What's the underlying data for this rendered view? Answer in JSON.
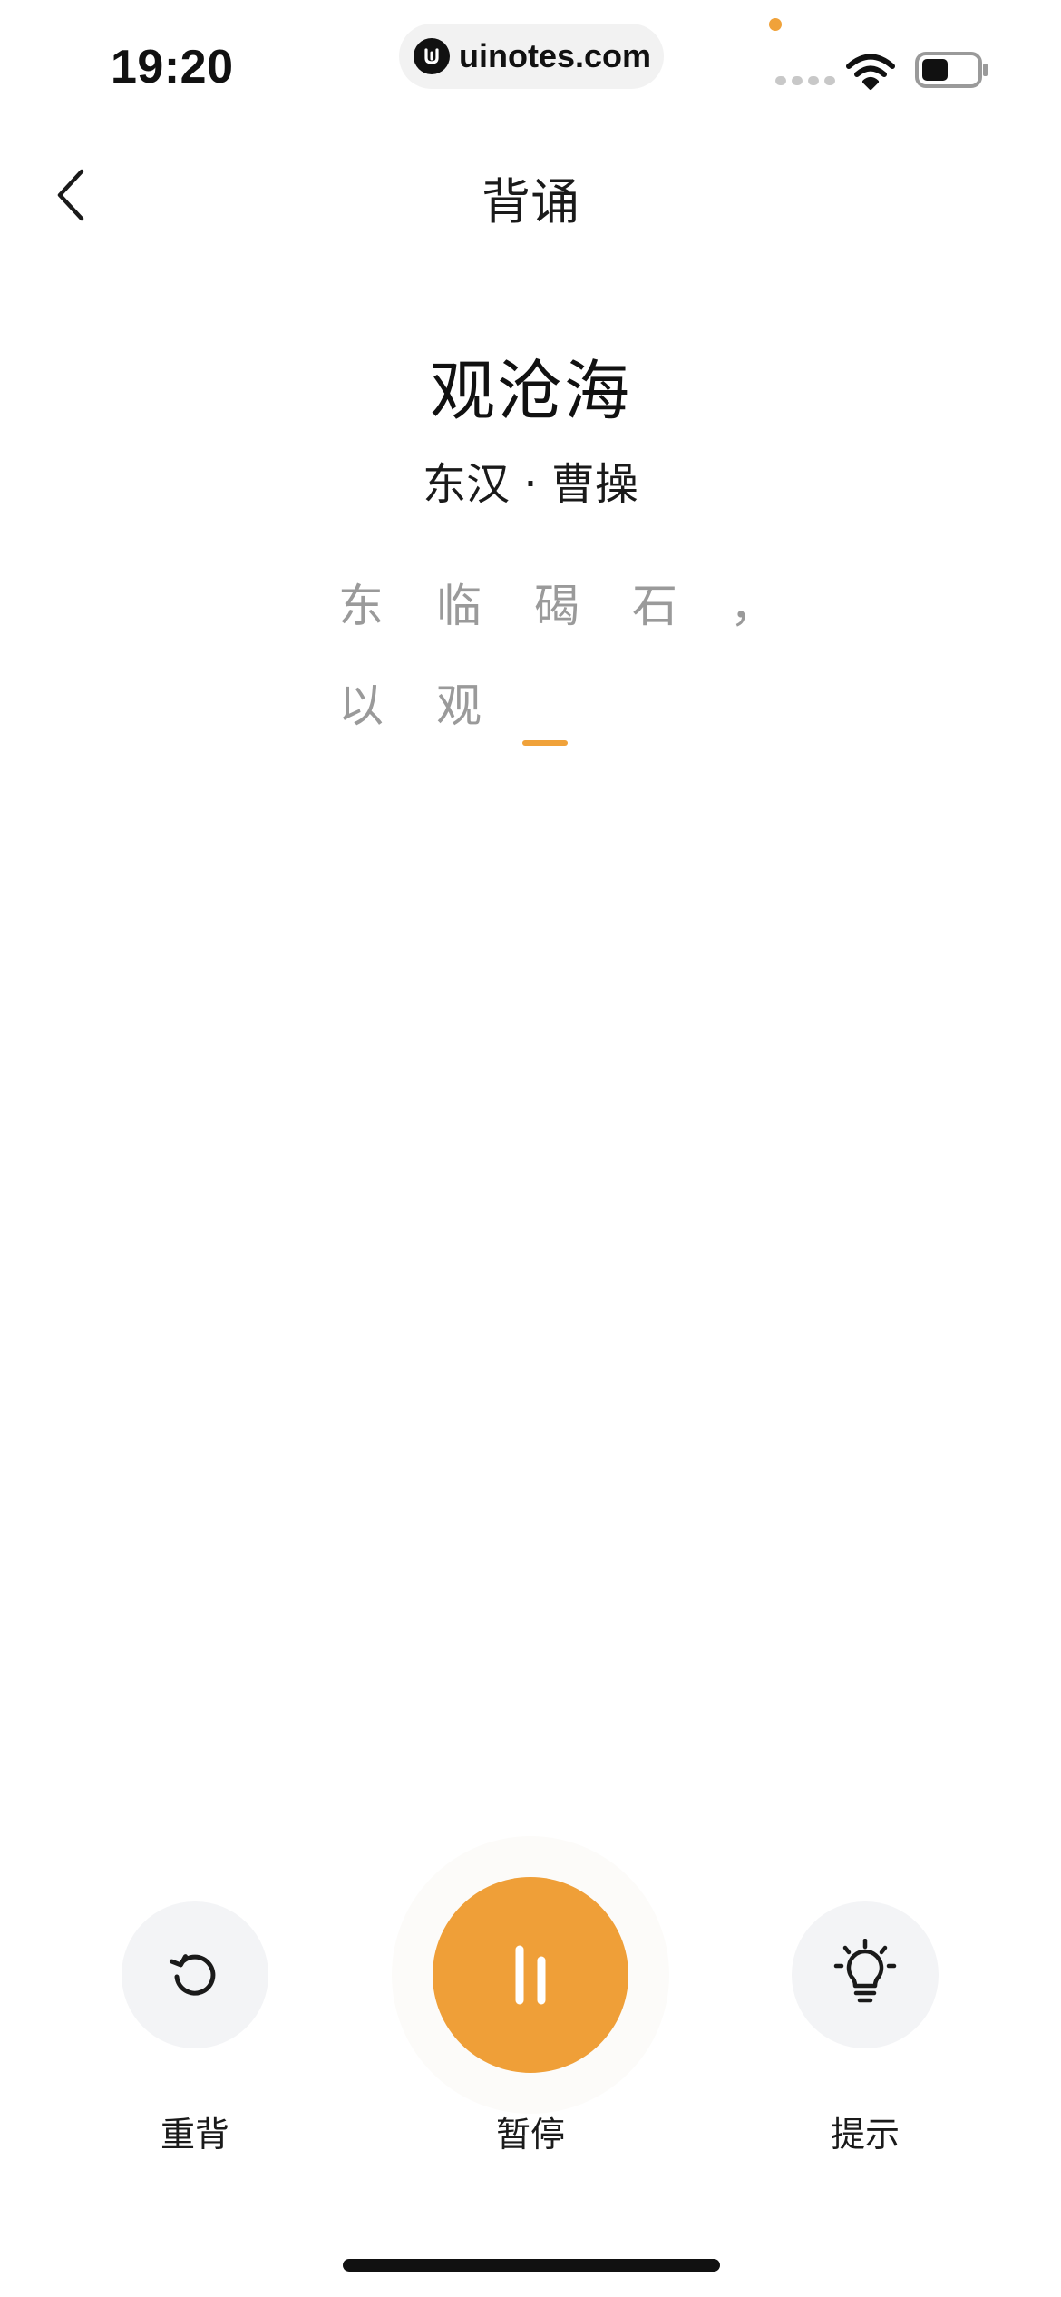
{
  "status_bar": {
    "time": "19:20",
    "watermark": "uinotes.com",
    "accent_dot_color": "#f0a23a"
  },
  "nav": {
    "back_icon": "chevron-left-icon",
    "title": "背诵"
  },
  "poem": {
    "title": "观沧海",
    "author": "东汉 · 曹操",
    "lines": [
      [
        "东",
        "临",
        "碣",
        "石",
        "，"
      ],
      [
        "以",
        "观"
      ]
    ],
    "cursor_color": "#f0a23a"
  },
  "controls": {
    "restart": {
      "label": "重背",
      "icon": "restart-icon"
    },
    "pause": {
      "label": "暂停",
      "icon": "pause-icon",
      "color": "#ef9f38"
    },
    "hint": {
      "label": "提示",
      "icon": "lightbulb-icon"
    }
  }
}
